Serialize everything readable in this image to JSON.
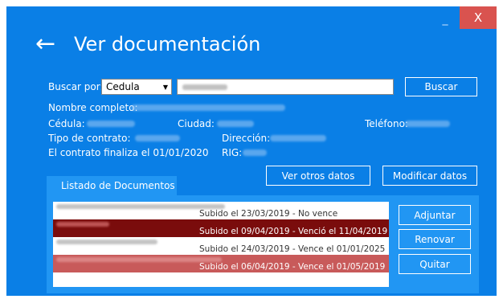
{
  "window": {
    "minimize_glyph": "_",
    "close_glyph": "X"
  },
  "header": {
    "back_glyph": "←",
    "title": "Ver documentación"
  },
  "search": {
    "label": "Buscar por:",
    "selected": "Cedula",
    "button": "Buscar"
  },
  "info": {
    "nombre": "Nombre completo:",
    "cedula": "Cédula:",
    "ciudad": "Ciudad:",
    "telefono": "Teléfono:",
    "tipo": "Tipo de contrato:",
    "direccion": "Dirección:",
    "finaliza": "El contrato finaliza el 01/01/2020",
    "rig": "RIG:"
  },
  "actions": {
    "ver_otros": "Ver otros datos",
    "modificar": "Modificar datos"
  },
  "documents": {
    "tab": "Listado de Documentos",
    "rows": [
      {
        "status": "Subido el 23/03/2019 - No vence"
      },
      {
        "status": "Subido el 09/04/2019 - Venció el 11/04/2019"
      },
      {
        "status": "Subido el 24/03/2019 - Vence el 01/01/2025"
      },
      {
        "status": "Subido el 06/04/2019 - Vence el 01/05/2019"
      }
    ],
    "buttons": {
      "adjuntar": "Adjuntar",
      "renovar": "Renovar",
      "quitar": "Quitar"
    }
  },
  "colors": {
    "window_bg": "#0a7fe6",
    "panel_bg": "#2196f3",
    "close_bg": "#d9534f",
    "expired_row": "#7a0c0c",
    "expiring_row": "#c85a5a"
  }
}
